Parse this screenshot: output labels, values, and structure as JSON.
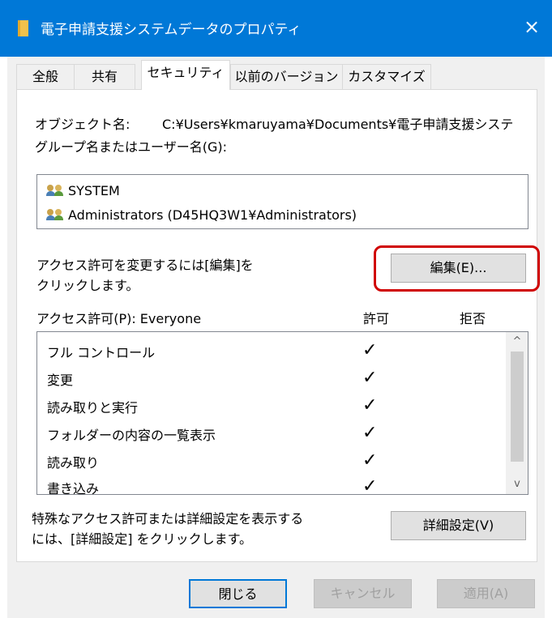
{
  "window": {
    "title": "電子申請支援システムデータのプロパティ",
    "close_icon": "×"
  },
  "tabs": [
    {
      "label": "全般"
    },
    {
      "label": "共有"
    },
    {
      "label": "セキュリティ",
      "active": true
    },
    {
      "label": "以前のバージョン"
    },
    {
      "label": "カスタマイズ"
    }
  ],
  "security": {
    "object_name_label": "オブジェクト名:",
    "object_name_value": "C:¥Users¥kmaruyama¥Documents¥電子申請支援システ",
    "group_label": "グループ名またはユーザー名(G):",
    "users": [
      {
        "name": "SYSTEM",
        "icon": "users-icon"
      },
      {
        "name": "Administrators (D45HQ3W1¥Administrators)",
        "icon": "users-icon"
      }
    ],
    "change_hint_line1": "アクセス許可を変更するには[編集]を",
    "change_hint_line2": "クリックします。",
    "edit_button": "編集(E)...",
    "permissions_label": "アクセス許可(P): Everyone",
    "allow_header": "許可",
    "deny_header": "拒否",
    "permissions": [
      {
        "name": "フル コントロール",
        "allow": "✓",
        "deny": ""
      },
      {
        "name": "変更",
        "allow": "✓",
        "deny": ""
      },
      {
        "name": "読み取りと実行",
        "allow": "✓",
        "deny": ""
      },
      {
        "name": "フォルダーの内容の一覧表示",
        "allow": "✓",
        "deny": ""
      },
      {
        "name": "読み取り",
        "allow": "✓",
        "deny": ""
      },
      {
        "name": "書き込み",
        "allow": "✓",
        "deny": ""
      }
    ],
    "scroll_up": "^",
    "scroll_down": "v",
    "advanced_hint_line1": "特殊なアクセス許可または詳細設定を表示する",
    "advanced_hint_line2": "には、[詳細設定] をクリックします。",
    "advanced_button": "詳細設定(V)"
  },
  "footer": {
    "close_button": "閉じる",
    "cancel_button": "キャンセル",
    "apply_button": "適用(A)"
  },
  "colors": {
    "titlebar": "#0078d7",
    "highlight": "#d00000"
  }
}
